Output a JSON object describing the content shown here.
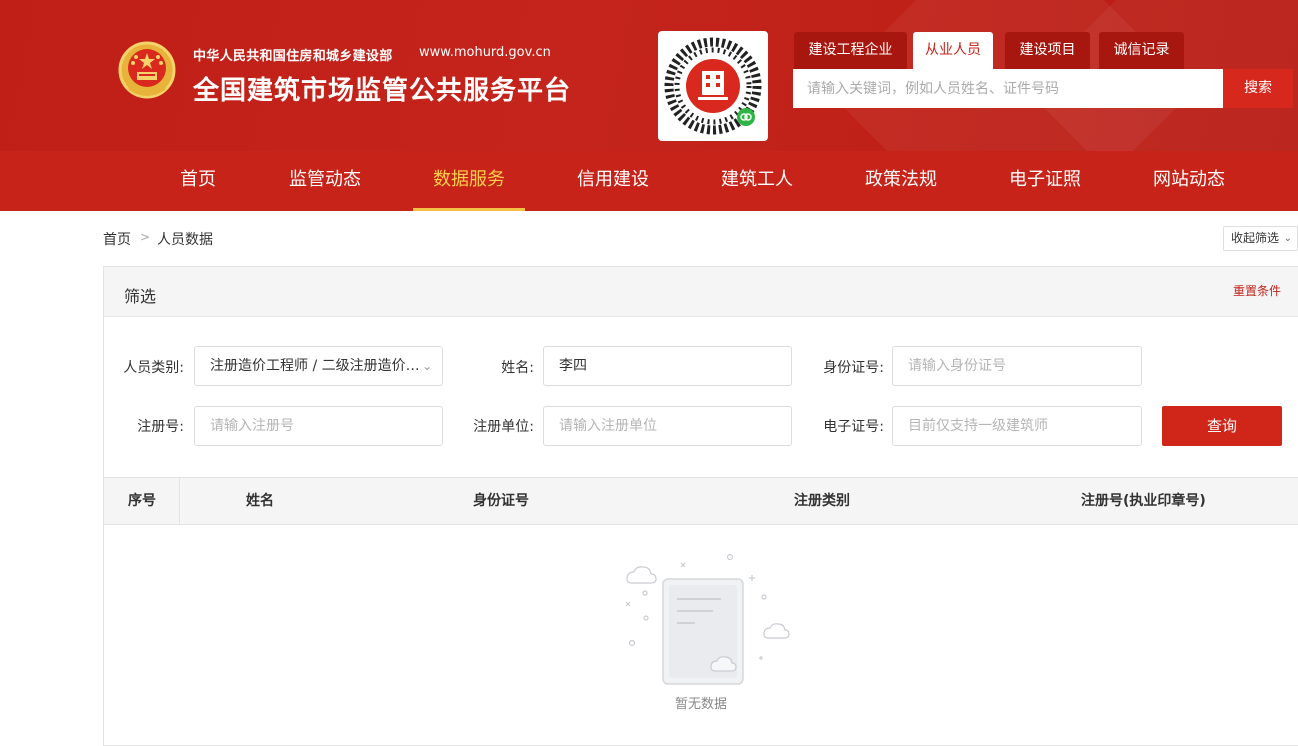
{
  "header": {
    "subtitle": "中华人民共和国住房和城乡建设部",
    "url": "www.mohurd.gov.cn",
    "title": "全国建筑市场监管公共服务平台"
  },
  "search": {
    "tabs": [
      {
        "label": "建设工程企业"
      },
      {
        "label": "从业人员"
      },
      {
        "label": "建设项目"
      },
      {
        "label": "诚信记录"
      }
    ],
    "active_tab": "从业人员",
    "placeholder": "请输入关键词，例如人员姓名、证件号码",
    "button": "搜索"
  },
  "nav": {
    "items": [
      {
        "label": "首页"
      },
      {
        "label": "监管动态"
      },
      {
        "label": "数据服务"
      },
      {
        "label": "信用建设"
      },
      {
        "label": "建筑工人"
      },
      {
        "label": "政策法规"
      },
      {
        "label": "电子证照"
      },
      {
        "label": "网站动态"
      }
    ],
    "active": "数据服务"
  },
  "breadcrumb": {
    "home": "首页",
    "current": "人员数据"
  },
  "collapse_label": "收起筛选",
  "filter": {
    "title": "筛选",
    "reset": "重置条件",
    "category_label": "人员类别:",
    "category_value": "注册造价工程师 / 二级注册造价…",
    "name_label": "姓名:",
    "name_value": "李四",
    "id_label": "身份证号:",
    "id_placeholder": "请输入身份证号",
    "reg_no_label": "注册号:",
    "reg_no_placeholder": "请输入注册号",
    "reg_unit_label": "注册单位:",
    "reg_unit_placeholder": "请输入注册单位",
    "ecert_label": "电子证号:",
    "ecert_placeholder": "目前仅支持一级建筑师",
    "query_button": "查询"
  },
  "table": {
    "columns": [
      "序号",
      "姓名",
      "身份证号",
      "注册类别",
      "注册号(执业印章号)"
    ],
    "rows": [],
    "empty_text": "暂无数据"
  },
  "colors": {
    "brand_red": "#c4241b",
    "nav_active": "#ffcf4d",
    "query_button": "#d0261a"
  }
}
